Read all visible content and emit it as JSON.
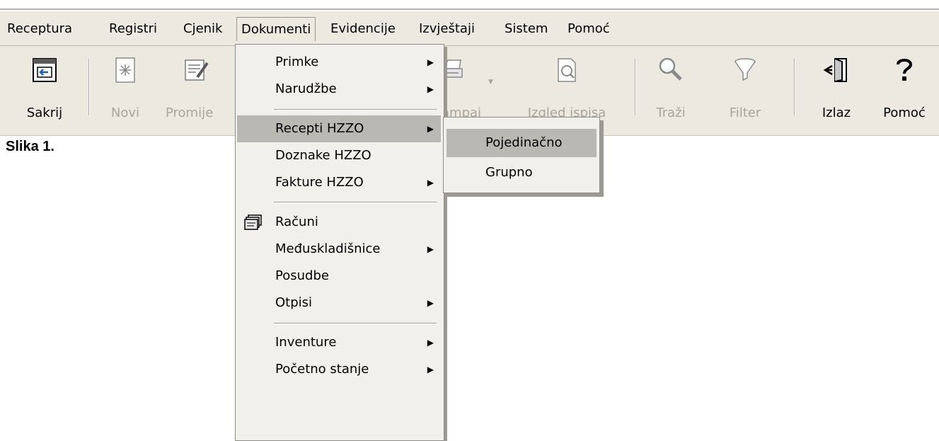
{
  "menubar": {
    "items": [
      {
        "label": "Receptura"
      },
      {
        "label": "Registri"
      },
      {
        "label": "Cjenik"
      },
      {
        "label": "Dokumenti"
      },
      {
        "label": "Evidencije"
      },
      {
        "label": "Izvještaji"
      },
      {
        "label": "Sistem"
      },
      {
        "label": "Pomoć"
      }
    ]
  },
  "toolbar": {
    "buttons": [
      {
        "label": "Sakrij",
        "icon": "hide-window-icon",
        "enabled": true
      },
      {
        "label": "Novi",
        "icon": "new-document-icon",
        "enabled": false
      },
      {
        "label": "Promije",
        "icon": "edit-document-icon",
        "enabled": false
      },
      {
        "label": "ampaj",
        "icon": "printer-icon",
        "enabled": false
      },
      {
        "label": "Izgled ispisa",
        "icon": "print-preview-icon",
        "enabled": false
      },
      {
        "label": "Traži",
        "icon": "search-magnifier-icon",
        "enabled": false
      },
      {
        "label": "Filter",
        "icon": "filter-funnel-icon",
        "enabled": false
      },
      {
        "label": "Izlaz",
        "icon": "exit-door-icon",
        "enabled": true
      },
      {
        "label": "Pomoć",
        "icon": "help-question-icon",
        "enabled": true
      }
    ]
  },
  "caption": "Slika 1.",
  "dropdown": {
    "items": [
      {
        "label": "Primke",
        "submenu": true
      },
      {
        "label": "Narudžbe",
        "submenu": true
      },
      {
        "label": "Recepti HZZO",
        "submenu": true,
        "highlighted": true
      },
      {
        "label": "Doznake HZZO",
        "submenu": false
      },
      {
        "label": "Fakture HZZO",
        "submenu": true
      },
      {
        "label": "Računi",
        "submenu": false,
        "icon": "invoice-stack-icon"
      },
      {
        "label": "Međuskladišnice",
        "submenu": true
      },
      {
        "label": "Posudbe",
        "submenu": false
      },
      {
        "label": "Otpisi",
        "submenu": true
      },
      {
        "label": "Inventure",
        "submenu": true
      },
      {
        "label": "Početno stanje",
        "submenu": true
      }
    ],
    "arrow_glyph": "▶"
  },
  "submenu": {
    "items": [
      {
        "label": "Pojedinačno",
        "highlighted": true
      },
      {
        "label": "Grupno"
      }
    ]
  },
  "colors": {
    "menu_bg": "#ece9e0",
    "highlight": "#b9b8b3",
    "disabled_text": "#a8a59e"
  }
}
